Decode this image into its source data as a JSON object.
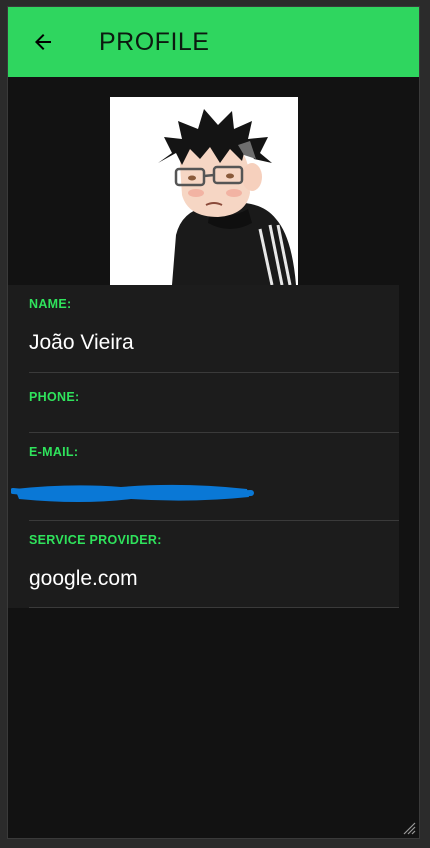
{
  "appbar": {
    "title": "PROFILE",
    "back_icon": "arrow-left-icon",
    "color": "#2fd65f"
  },
  "avatar": {
    "icon": "user-avatar-illustration"
  },
  "fields": {
    "name": {
      "label": "NAME:",
      "value": "João Vieira"
    },
    "phone": {
      "label": "PHONE:",
      "value": ""
    },
    "email": {
      "label": "E-MAIL:",
      "value": ""
    },
    "provider": {
      "label": "SERVICE PROVIDER:",
      "value": "google.com"
    }
  },
  "colors": {
    "accent": "#2fd65f",
    "label": "#2fe35c",
    "background": "#121212",
    "card": "#1c1c1c",
    "redaction": "#0a78d6"
  }
}
